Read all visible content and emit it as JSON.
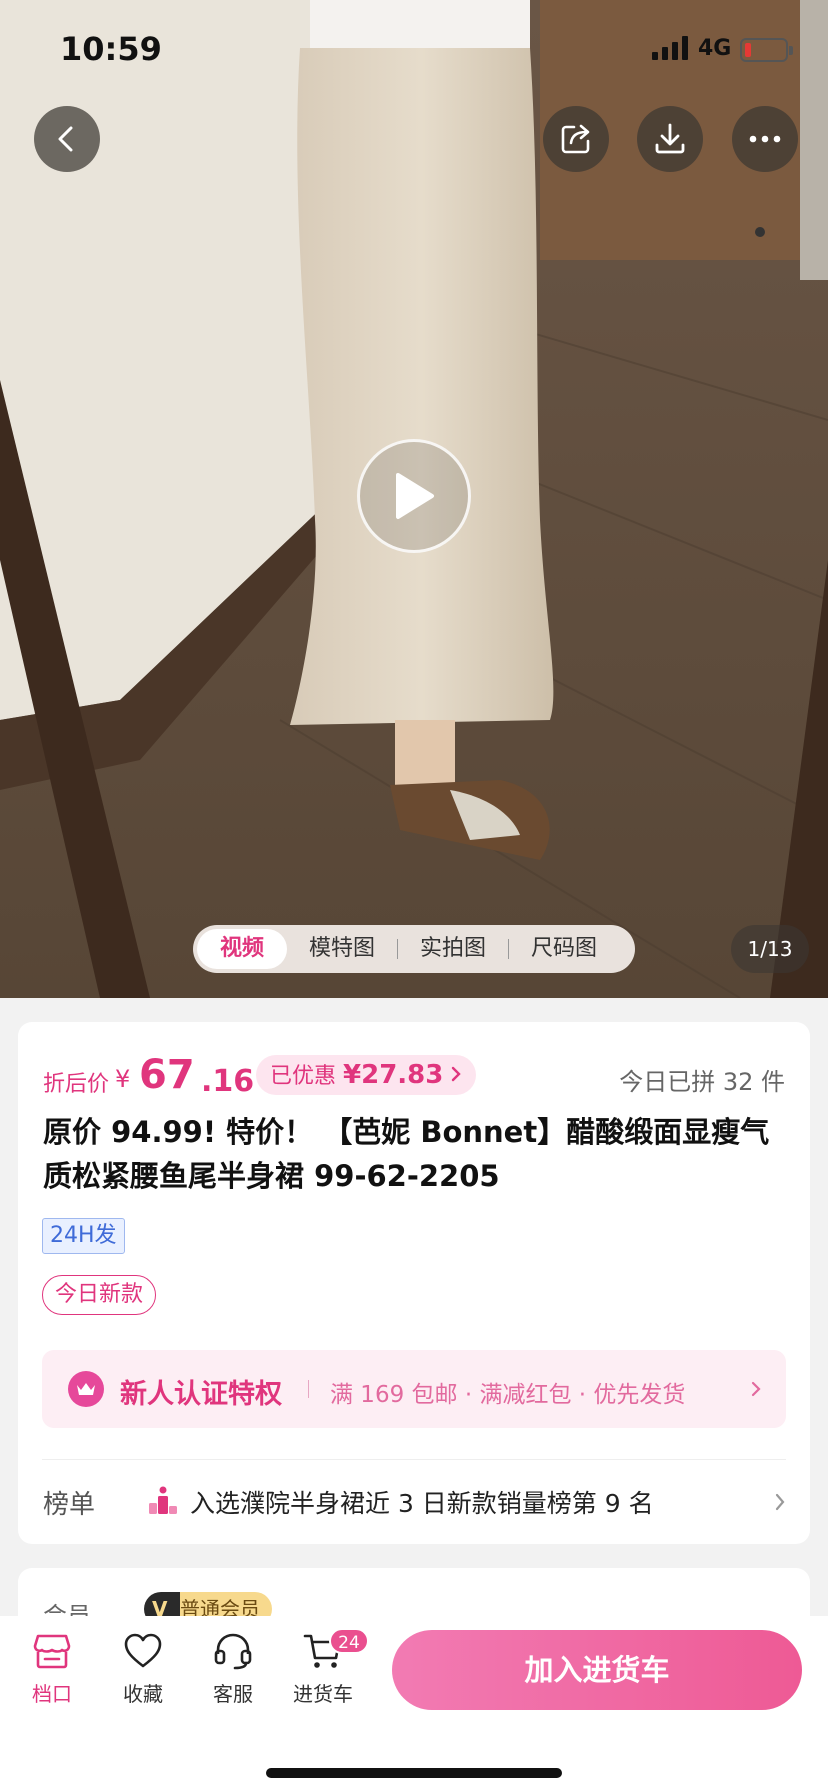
{
  "status_bar": {
    "time": "10:59",
    "network": "4G"
  },
  "media": {
    "tabs": [
      "视频",
      "模特图",
      "实拍图",
      "尺码图"
    ],
    "active_tab": "视频",
    "counter": "1/13"
  },
  "product": {
    "price_label": "折后价",
    "currency": "¥",
    "price_int": "67",
    "price_dec": ".16",
    "discount_prefix": "已优惠",
    "discount_amount": "¥27.83",
    "today_count": "今日已拼 32 件",
    "title": "原价 94.99! 特价！ 【芭妮 Bonnet】醋酸缎面显瘦气质松紧腰鱼尾半身裙 99-62-2205",
    "ship_tag": "24H发",
    "new_tag": "今日新款"
  },
  "promo": {
    "title": "新人认证特权",
    "detail": "满 169 包邮 · 满减红包 · 优先发货"
  },
  "ranking": {
    "label": "榜单",
    "text": "入选濮院半身裙近 3 日新款销量榜第 9 名"
  },
  "membership": {
    "label": "会员",
    "badge": "普通会员"
  },
  "bottom_nav": {
    "items": [
      {
        "label": "档口",
        "icon": "store-icon"
      },
      {
        "label": "收藏",
        "icon": "heart-icon"
      },
      {
        "label": "客服",
        "icon": "headset-icon"
      },
      {
        "label": "进货车",
        "icon": "cart-icon"
      }
    ],
    "cart_count": "24",
    "add_to_cart": "加入进货车"
  },
  "colors": {
    "accent": "#e0357d",
    "tag_blue": "#3f6bd8"
  }
}
